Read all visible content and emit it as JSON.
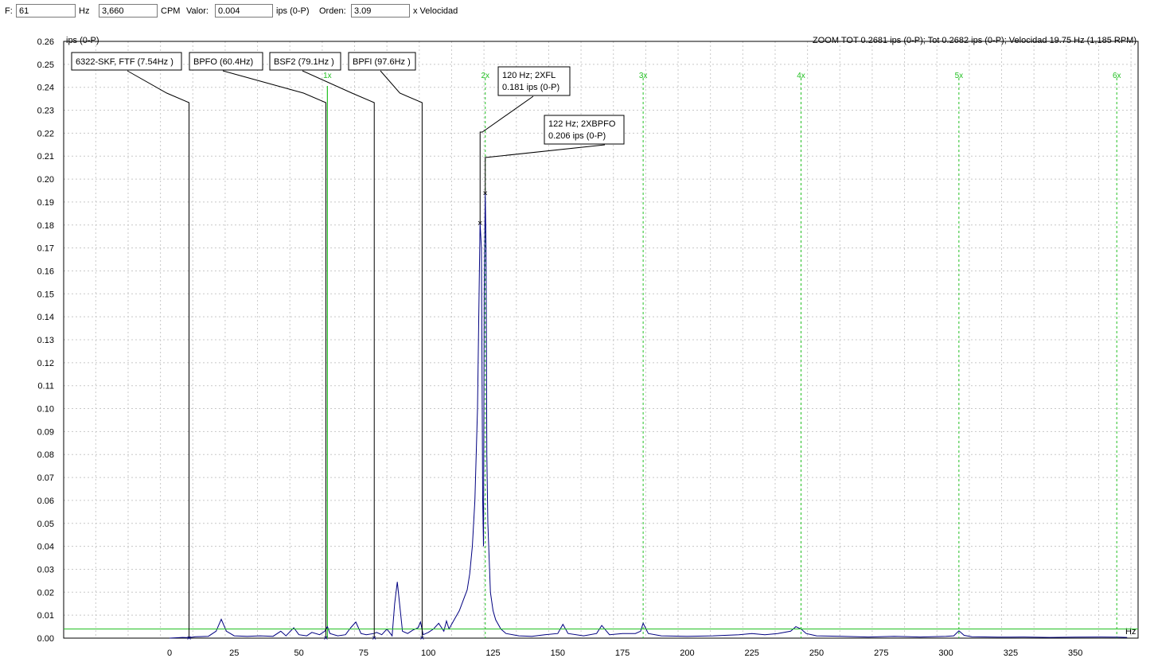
{
  "toolbar": {
    "f_label": "F:",
    "f_value": "61",
    "hz_label": "Hz",
    "cpm_value": "3,660",
    "cpm_label": "CPM",
    "valor_label": "Valor:",
    "valor_value": "0.004",
    "valor_unit": "ips (0-P)",
    "orden_label": "Orden:",
    "orden_value": "3.09",
    "orden_unit": "x Velocidad"
  },
  "chart_data": {
    "type": "line",
    "ylabel": "ips (0-P)",
    "xlabel": "Hz",
    "summary": "ZOOM TOT 0.2681 ips (0-P); Tot 0.2682 ips (0-P); Velocidad 19.75 Hz (1,185 RPM)",
    "xlim": [
      -41,
      375
    ],
    "ylim": [
      0,
      0.26
    ],
    "x_ticks": [
      0,
      25,
      50,
      75,
      100,
      125,
      150,
      175,
      200,
      225,
      250,
      275,
      300,
      325,
      350
    ],
    "y_ticks": [
      0,
      0.01,
      0.02,
      0.03,
      0.04,
      0.05,
      0.06,
      0.07,
      0.08,
      0.09,
      0.1,
      0.11,
      0.12,
      0.13,
      0.14,
      0.15,
      0.16,
      0.17,
      0.18,
      0.19,
      0.2,
      0.21,
      0.22,
      0.23,
      0.24,
      0.25,
      0.26
    ],
    "y_tick_labels": [
      "0.00",
      "0.01",
      "0.02",
      "0.03",
      "0.04",
      "0.05",
      "0.06",
      "0.07",
      "0.08",
      "0.09",
      "0.10",
      "0.11",
      "0.12",
      "0.13",
      "0.14",
      "0.15",
      "0.16",
      "0.17",
      "0.18",
      "0.19",
      "0.20",
      "0.21",
      "0.22",
      "0.23",
      "0.24",
      "0.25",
      "0.26"
    ],
    "grid": true,
    "colors": {
      "spectrum": "#000080",
      "harmonics": "#22c022",
      "cursor": "#22c022",
      "annotation": "#000000",
      "grid": "#c8c8c8"
    },
    "cursor": {
      "x": 61,
      "y": 0.004
    },
    "harmonics": [
      {
        "label": "1x",
        "x": 61
      },
      {
        "label": "2x",
        "x": 122
      },
      {
        "label": "3x",
        "x": 183
      },
      {
        "label": "4x",
        "x": 244
      },
      {
        "label": "5x",
        "x": 305
      },
      {
        "label": "6x",
        "x": 366
      }
    ],
    "fault_markers": [
      {
        "label": "6322-SKF, FTF (7.54Hz )",
        "x": 7.54
      },
      {
        "label": "BPFO (60.4Hz)",
        "x": 60.4
      },
      {
        "label": "BSF2 (79.1Hz )",
        "x": 79.1
      },
      {
        "label": "BPFI (97.6Hz )",
        "x": 97.6
      }
    ],
    "peak_annotations": [
      {
        "line1": "120 Hz; 2XFL",
        "line2": "0.181 ips (0-P)",
        "x": 120,
        "y": 0.181
      },
      {
        "line1": "122 Hz; 2XBPFO",
        "line2": "0.206 ips (0-P)",
        "x": 122,
        "y": 0.194
      }
    ],
    "series": [
      {
        "x": [
          0,
          5,
          7.54,
          10,
          15,
          18,
          20,
          22,
          25,
          30,
          35,
          40,
          43,
          45,
          48,
          50,
          53,
          55,
          58,
          60,
          61,
          62,
          65,
          68,
          70,
          72,
          74,
          76,
          79,
          80,
          82,
          84,
          86,
          87,
          88,
          90,
          92,
          94,
          96,
          97,
          98,
          100,
          102,
          104,
          106,
          107,
          108,
          110,
          112,
          114,
          115,
          116,
          117,
          118,
          119,
          120,
          120.5,
          121,
          121.3,
          121.6,
          122,
          122.3,
          122.6,
          123,
          124,
          125,
          126,
          128,
          130,
          135,
          140,
          145,
          150,
          152,
          154,
          160,
          165,
          167,
          170,
          175,
          180,
          182,
          183,
          185,
          190,
          200,
          210,
          220,
          225,
          230,
          235,
          240,
          242,
          244,
          246,
          250,
          260,
          270,
          280,
          290,
          300,
          303,
          305,
          307,
          310,
          320,
          330,
          340,
          350,
          360,
          366,
          370
        ],
        "y": [
          0,
          0.0003,
          0.0002,
          0.0006,
          0.0008,
          0.003,
          0.0082,
          0.003,
          0.001,
          0.0008,
          0.001,
          0.0008,
          0.003,
          0.001,
          0.0045,
          0.0015,
          0.001,
          0.0025,
          0.0015,
          0.003,
          0.005,
          0.002,
          0.001,
          0.0015,
          0.0045,
          0.007,
          0.002,
          0.0015,
          0.002,
          0.0025,
          0.0015,
          0.004,
          0.001,
          0.015,
          0.0245,
          0.003,
          0.002,
          0.0035,
          0.0045,
          0.007,
          0.0015,
          0.0025,
          0.004,
          0.0065,
          0.003,
          0.0075,
          0.004,
          0.008,
          0.012,
          0.018,
          0.021,
          0.028,
          0.04,
          0.06,
          0.1,
          0.181,
          0.17,
          0.06,
          0.04,
          0.15,
          0.194,
          0.17,
          0.08,
          0.05,
          0.02,
          0.012,
          0.008,
          0.004,
          0.002,
          0.001,
          0.0008,
          0.0015,
          0.002,
          0.006,
          0.002,
          0.001,
          0.002,
          0.0055,
          0.0015,
          0.002,
          0.002,
          0.003,
          0.0065,
          0.002,
          0.001,
          0.0008,
          0.001,
          0.0015,
          0.002,
          0.0015,
          0.002,
          0.003,
          0.005,
          0.004,
          0.002,
          0.001,
          0.0008,
          0.0005,
          0.0008,
          0.0005,
          0.0008,
          0.001,
          0.0032,
          0.0012,
          0.0006,
          0.0004,
          0.0005,
          0.0003,
          0.0004,
          0.0005,
          0.0004,
          0.0003
        ]
      }
    ]
  }
}
